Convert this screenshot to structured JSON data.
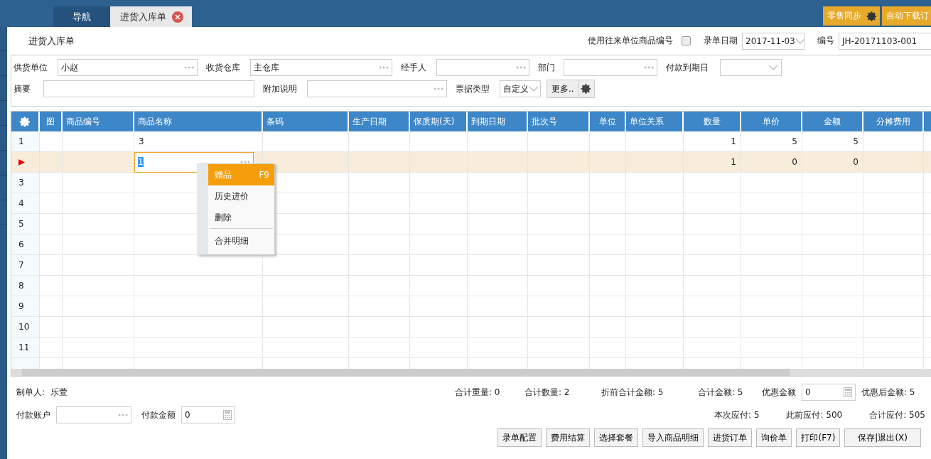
{
  "tabs": [
    {
      "label": "导航",
      "selected": false
    },
    {
      "label": "进货入库单",
      "selected": true
    }
  ],
  "top_buttons": [
    "零售同步",
    "自动下载订"
  ],
  "form_title": "进货入库单",
  "header_fields": {
    "partner_code": {
      "label": "使用往来单位商品编号",
      "checked": false
    },
    "date": {
      "label": "录单日期",
      "value": "2017-11-03"
    },
    "number": {
      "label": "编号",
      "value": "JH-20171103-001"
    }
  },
  "form_rows": [
    [
      {
        "label": "供货单位",
        "kind": "lookup",
        "value": "小赵"
      },
      {
        "label": "收货仓库",
        "kind": "lookup",
        "value": "主仓库"
      },
      {
        "label": "经手人",
        "kind": "lookup"
      },
      {
        "label": "部门",
        "kind": "lookup"
      },
      {
        "label": "付款到期日",
        "kind": "select"
      }
    ],
    [
      {
        "label": "摘要",
        "kind": "text"
      },
      {
        "label": "附加说明",
        "kind": "lookup"
      },
      {
        "label": "票据类型",
        "kind": "select",
        "value": "自定义"
      },
      {
        "kind": "more",
        "value": "更多.."
      }
    ]
  ],
  "grid": {
    "columns": [
      {
        "kind": "settings"
      },
      {
        "label": "图"
      },
      {
        "label": "商品编号"
      },
      {
        "label": "商品名称"
      },
      {
        "label": "条码"
      },
      {
        "label": "生产日期"
      },
      {
        "label": "保质期(天)"
      },
      {
        "label": "到期日期"
      },
      {
        "label": "批次号"
      },
      {
        "label": "单位"
      },
      {
        "label": "单位关系"
      },
      {
        "label": "数量"
      },
      {
        "label": "单价"
      },
      {
        "label": "金额"
      },
      {
        "label": "分摊费用"
      }
    ],
    "rows": [
      {
        "number": "1",
        "selected": false,
        "cells": [
          null,
          null,
          "3",
          null,
          null,
          null,
          null,
          null,
          null,
          null,
          "1",
          "5",
          "5",
          null
        ]
      },
      {
        "selected": true,
        "cells": [
          null,
          null,
          "1",
          null,
          null,
          null,
          null,
          null,
          null,
          null,
          "1",
          "0",
          "0",
          null
        ]
      },
      {
        "number": "3",
        "selected": false
      },
      {
        "number": "4",
        "selected": false
      },
      {
        "number": "5",
        "selected": false
      },
      {
        "number": "6",
        "selected": false
      },
      {
        "number": "7",
        "selected": false
      },
      {
        "number": "8",
        "selected": false
      },
      {
        "number": "9",
        "selected": false
      },
      {
        "number": "10",
        "selected": false
      },
      {
        "number": "11",
        "selected": false
      },
      {
        "selected": false
      }
    ]
  },
  "context_menu": [
    {
      "label": "赠品",
      "shortcut": "F9",
      "selected": true
    },
    {
      "label": "历史进价",
      "selected": false
    },
    {
      "label": "删除",
      "selected": false
    },
    {
      "label": "合并明细",
      "selected": false
    }
  ],
  "creator": {
    "label": "制单人:",
    "value": "乐萱"
  },
  "totals": [
    {
      "kind": "stat",
      "label": "合计重量:",
      "value": "0"
    },
    {
      "kind": "stat",
      "label": "合计数量:",
      "value": "2"
    },
    {
      "kind": "stat",
      "label": "折前合计金额:",
      "value": "5"
    },
    {
      "kind": "stat",
      "label": "合计金额:",
      "value": "5"
    },
    {
      "kind": "input",
      "label": "优惠金额",
      "value": "0"
    },
    {
      "kind": "stat",
      "label": "优惠后金额:",
      "value": "5"
    }
  ],
  "payment": [
    {
      "kind": "lookup",
      "label": "付款账户"
    },
    {
      "kind": "input",
      "label": "付款金额",
      "value": "0"
    }
  ],
  "payables": [
    {
      "label": "本次应付:",
      "value": "5"
    },
    {
      "label": "此前应付:",
      "value": "500"
    },
    {
      "label": "合计应付:",
      "value": "505"
    }
  ],
  "actions": [
    "录单配置",
    "费用结算",
    "选择套餐",
    "导入商品明细",
    "进货订单",
    "询价单",
    "打印(F7)",
    "保存|退出(X)"
  ]
}
